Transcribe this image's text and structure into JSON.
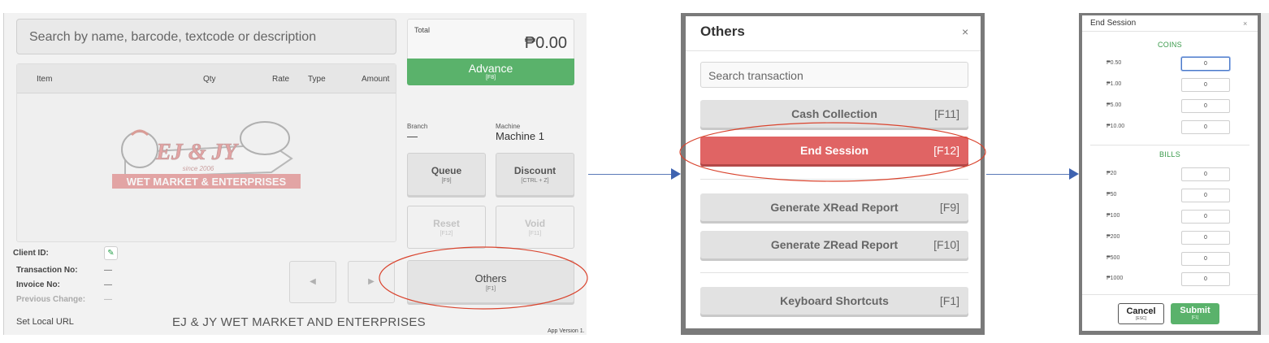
{
  "pos": {
    "search_placeholder": "Search by name, barcode, textcode or description",
    "columns": [
      "Item",
      "Qty",
      "Rate",
      "Type",
      "Amount"
    ],
    "logo": {
      "brand": "EJ & JY",
      "since": "since 2006",
      "tagline": "WET MARKET & ENTERPRISES"
    },
    "client_id_label": "Client ID:",
    "transaction_no_label": "Transaction No:",
    "transaction_no_value": "—",
    "invoice_no_label": "Invoice No:",
    "invoice_no_value": "—",
    "previous_change_label": "Previous Change:",
    "previous_change_value": "—",
    "set_local_url": "Set Local URL",
    "company_name": "EJ & JY WET MARKET AND ENTERPRISES",
    "app_version": "App Version 1.",
    "total_label": "Total",
    "total_value": "₱0.00",
    "advance_label": "Advance",
    "advance_key": "[F8]",
    "branch_label": "Branch",
    "branch_value": "—",
    "machine_label": "Machine",
    "machine_value": "Machine 1",
    "queue_label": "Queue",
    "queue_key": "[F9]",
    "discount_label": "Discount",
    "discount_key": "[CTRL + Z]",
    "reset_label": "Reset",
    "reset_key": "[F12]",
    "void_label": "Void",
    "void_key": "[F11]",
    "others_label": "Others",
    "others_key": "[F1]",
    "prev_icon": "caret-left-icon",
    "next_icon": "caret-right-icon",
    "accent_green": "#5ab26b"
  },
  "others_modal": {
    "title": "Others",
    "close": "×",
    "search_placeholder": "Search transaction",
    "buttons": [
      {
        "label": "Cash Collection",
        "key": "[F11]"
      },
      {
        "label": "End Session",
        "key": "[F12]"
      },
      {
        "label": "Generate XRead Report",
        "key": "[F9]"
      },
      {
        "label": "Generate ZRead Report",
        "key": "[F10]"
      },
      {
        "label": "Keyboard Shortcuts",
        "key": "[F1]"
      }
    ],
    "danger_color": "#e06464"
  },
  "end_session_modal": {
    "title": "End Session",
    "close": "×",
    "coins_heading": "COINS",
    "coins": [
      {
        "label": "₱0.50",
        "value": "0"
      },
      {
        "label": "₱1.00",
        "value": "0"
      },
      {
        "label": "₱5.00",
        "value": "0"
      },
      {
        "label": "₱10.00",
        "value": "0"
      }
    ],
    "bills_heading": "BILLS",
    "bills": [
      {
        "label": "₱20",
        "value": "0"
      },
      {
        "label": "₱50",
        "value": "0"
      },
      {
        "label": "₱100",
        "value": "0"
      },
      {
        "label": "₱200",
        "value": "0"
      },
      {
        "label": "₱500",
        "value": "0"
      },
      {
        "label": "₱1000",
        "value": "0"
      }
    ],
    "cancel_label": "Cancel",
    "cancel_key": "[ESC]",
    "submit_label": "Submit",
    "submit_key": "[F1]"
  },
  "annotations": {
    "highlight_color": "#d9442e",
    "arrow_color": "#4a6fb5"
  }
}
